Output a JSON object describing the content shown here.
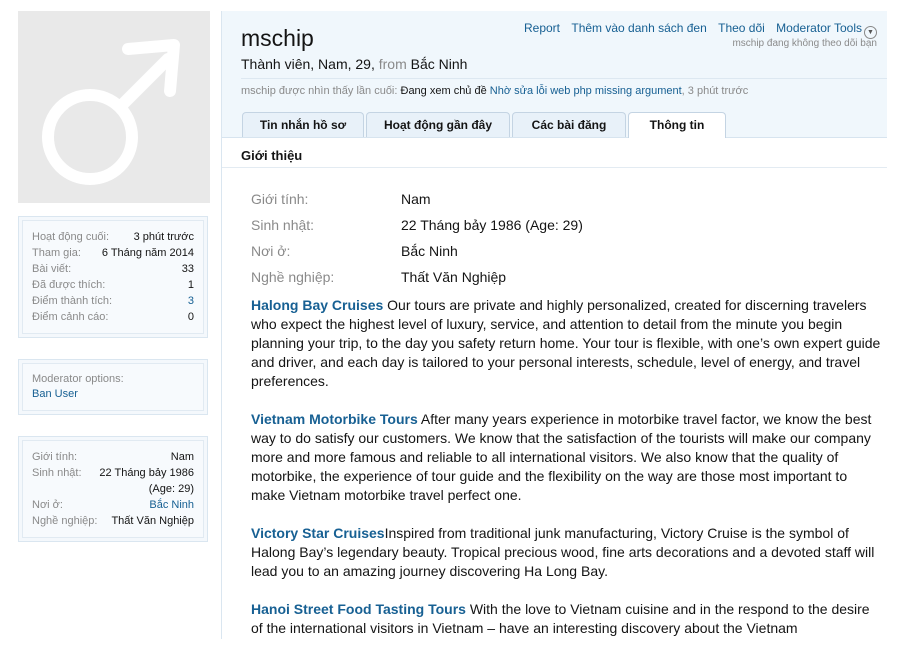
{
  "sidebar": {
    "stats": [
      {
        "label": "Hoạt động cuối:",
        "value": "3 phút trước",
        "link": false
      },
      {
        "label": "Tham gia:",
        "value": "6 Tháng năm 2014",
        "link": false
      },
      {
        "label": "Bài viết:",
        "value": "33",
        "link": false
      },
      {
        "label": "Đã được thích:",
        "value": "1",
        "link": false
      },
      {
        "label": "Điểm thành tích:",
        "value": "3",
        "link": true
      },
      {
        "label": "Điểm cảnh cáo:",
        "value": "0",
        "link": false
      }
    ],
    "moderator": {
      "title": "Moderator options:",
      "ban_label": "Ban User"
    },
    "info": {
      "gender_label": "Giới tính:",
      "gender": "Nam",
      "birthday_label": "Sinh nhật:",
      "birthday": "22 Tháng bảy 1986",
      "age": "(Age: 29)",
      "location_label": "Nơi ở:",
      "location": "Bắc Ninh",
      "occupation_label": "Nghề nghiệp:",
      "occupation": "Thất Văn Nghiệp"
    }
  },
  "header": {
    "username": "mschip",
    "blurb_prefix": "Thành viên, Nam, 29,",
    "blurb_from": "from",
    "blurb_location": "Bắc Ninh",
    "links": {
      "report": "Report",
      "ignore": "Thêm vào danh sách đen",
      "follow": "Theo dõi",
      "moderator_tools": "Moderator Tools"
    },
    "follow_note": "mschip đang không theo dõi bạn",
    "lastseen_prefix": "mschip được nhìn thấy lần cuối:",
    "lastseen_action": "Đang xem chủ đề",
    "lastseen_thread": "Nhờ sửa lỗi web php missing argument",
    "lastseen_time": ", 3 phút trước"
  },
  "tabs": [
    "Tin nhắn hồ sơ",
    "Hoạt động gần đây",
    "Các bài đăng",
    "Thông tin"
  ],
  "about": {
    "title": "Giới thiệu",
    "fields": [
      {
        "label": "Giới tính:",
        "value": "Nam"
      },
      {
        "label": "Sinh nhật:",
        "value": "22 Tháng bảy 1986 (Age: 29)"
      },
      {
        "label": "Nơi ở:",
        "value": "Bắc Ninh"
      },
      {
        "label": "Nghề nghiệp:",
        "value": "Thất Văn Nghiệp"
      }
    ],
    "paragraphs": [
      {
        "link": "Halong Bay Cruises",
        "text": " Our tours are private and highly personalized, created for discerning travelers who expect the highest level of luxury, service, and attention to detail from the minute you begin planning your trip, to the day you safety return home. Your tour is flexible, with one’s own expert guide and driver, and each day is tailored to your personal interests, schedule, level of energy, and travel preferences."
      },
      {
        "link": "Vietnam Motorbike Tours",
        "text": " After many years experience in motorbike travel factor, we know the best way to do satisfy our customers. We know that the satisfaction of the tourists will make our company more and more famous and reliable to all international visitors. We also know that the quality of motorbike, the experience of tour guide and the flexibility on the way are those most important to make Vietnam motorbike travel perfect one."
      },
      {
        "link": "Victory Star Cruises",
        "text": "Inspired from traditional junk manufacturing, Victory Cruise is the symbol of Halong Bay’s legendary beauty. Tropical precious wood, fine arts decorations and a devoted staff will lead you to an amazing journey discovering Ha Long Bay."
      },
      {
        "link": "Hanoi Street Food Tasting Tours",
        "text": " With the love to Vietnam cuisine and in the respond to the desire of the international visitors in Vietnam – have an interesting discovery about the Vietnam"
      }
    ]
  }
}
